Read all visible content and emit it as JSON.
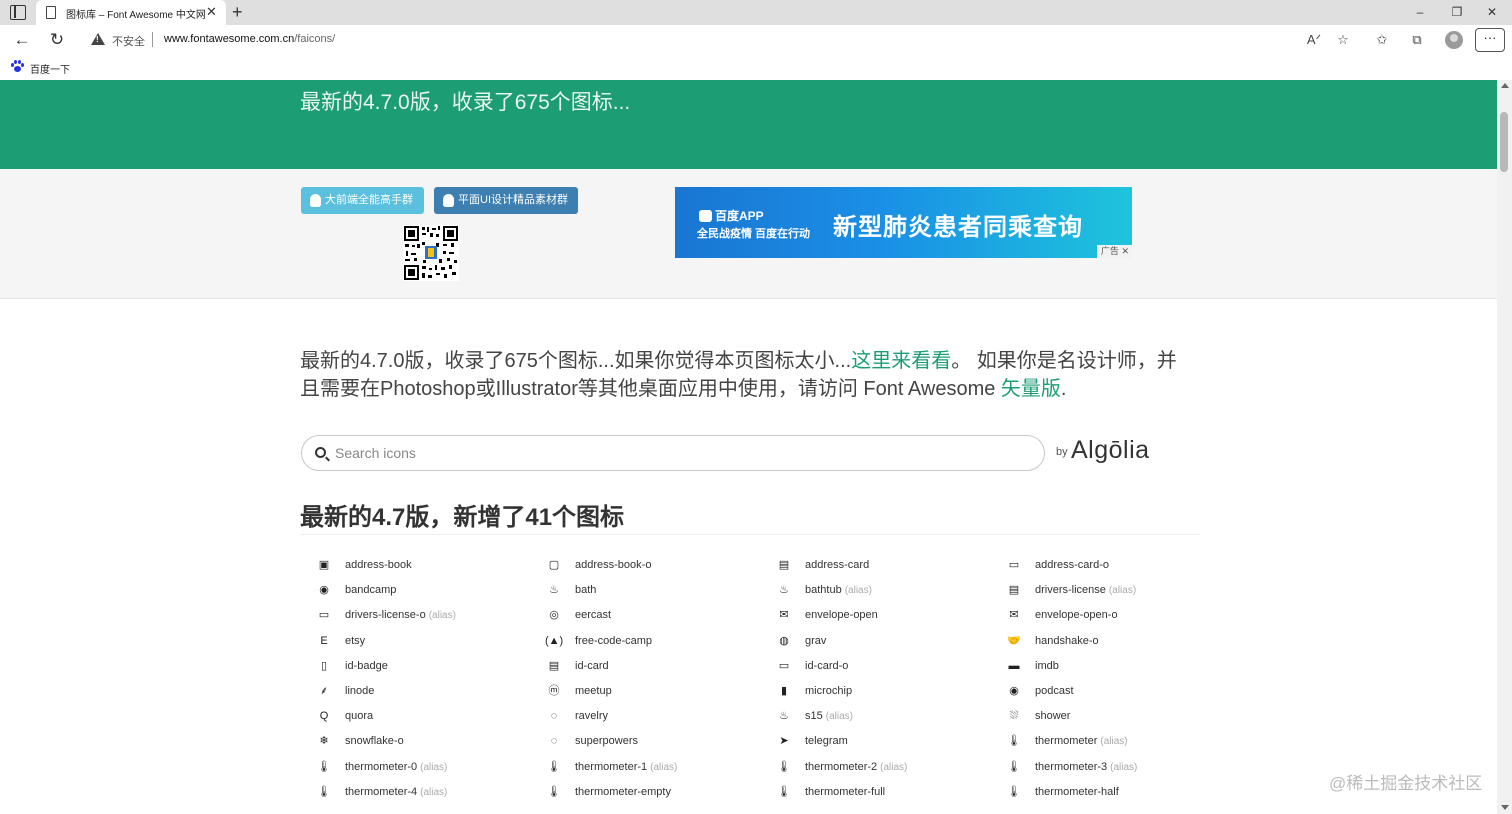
{
  "browser": {
    "tab_title": "图标库 – Font Awesome 中文网",
    "tab_close": "✕",
    "new_tab": "+",
    "security_label": "不安全",
    "url_host": "www.fontawesome.com.cn",
    "url_path": "/faicons/",
    "bookmark_label": "百度一下",
    "min_glyph": "–",
    "restore_glyph": "❐",
    "close_glyph": "✕",
    "back_glyph": "←",
    "reload_glyph": "↻",
    "read_aloud_glyph": "Aᐟ",
    "fav_add_glyph": "☆",
    "favorites_glyph": "✩",
    "collections_glyph": "⧉",
    "more_glyph": "···"
  },
  "hero": {
    "title": "最新的4.7.0版，收录了675个图标..."
  },
  "ads": {
    "group_btn_1": "大前端全能高手群",
    "group_btn_2": "平面UI设计精品素材群",
    "banner_app": "百度APP",
    "banner_sub": "全民战疫情 百度在行动",
    "banner_main": "新型肺炎患者同乘查询",
    "banner_ad_label": "广告",
    "banner_ad_close": "✕"
  },
  "intro": {
    "part1": "最新的4.7.0版，收录了675个图标...如果你觉得本页图标太小...",
    "link1": "这里来看看",
    "part2": "。 如果你是名设计师，并且需要在Photoshop或Illustrator等其他桌面应用中使用，请访问 Font Awesome ",
    "link2": "矢量版",
    "part3": "."
  },
  "search": {
    "placeholder": "Search icons",
    "by_label": "by",
    "provider": "Algōlia"
  },
  "section": {
    "title": "最新的4.7版，新增了41个图标"
  },
  "icons": [
    {
      "name": "address-book",
      "glyph": "▣",
      "alias": ""
    },
    {
      "name": "address-book-o",
      "glyph": "▢",
      "alias": ""
    },
    {
      "name": "address-card",
      "glyph": "▤",
      "alias": ""
    },
    {
      "name": "address-card-o",
      "glyph": "▭",
      "alias": ""
    },
    {
      "name": "bandcamp",
      "glyph": "◉",
      "alias": ""
    },
    {
      "name": "bath",
      "glyph": "♨",
      "alias": ""
    },
    {
      "name": "bathtub",
      "glyph": "♨",
      "alias": "(alias)"
    },
    {
      "name": "drivers-license",
      "glyph": "▤",
      "alias": "(alias)"
    },
    {
      "name": "drivers-license-o",
      "glyph": "▭",
      "alias": "(alias)"
    },
    {
      "name": "eercast",
      "glyph": "◎",
      "alias": ""
    },
    {
      "name": "envelope-open",
      "glyph": "✉",
      "alias": ""
    },
    {
      "name": "envelope-open-o",
      "glyph": "✉",
      "alias": ""
    },
    {
      "name": "etsy",
      "glyph": "E",
      "alias": ""
    },
    {
      "name": "free-code-camp",
      "glyph": "(▲)",
      "alias": ""
    },
    {
      "name": "grav",
      "glyph": "◍",
      "alias": ""
    },
    {
      "name": "handshake-o",
      "glyph": "🤝",
      "alias": ""
    },
    {
      "name": "id-badge",
      "glyph": "▯",
      "alias": ""
    },
    {
      "name": "id-card",
      "glyph": "▤",
      "alias": ""
    },
    {
      "name": "id-card-o",
      "glyph": "▭",
      "alias": ""
    },
    {
      "name": "imdb",
      "glyph": "▬",
      "alias": ""
    },
    {
      "name": "linode",
      "glyph": "⸙",
      "alias": ""
    },
    {
      "name": "meetup",
      "glyph": "ⓜ",
      "alias": ""
    },
    {
      "name": "microchip",
      "glyph": "▮",
      "alias": ""
    },
    {
      "name": "podcast",
      "glyph": "◉",
      "alias": ""
    },
    {
      "name": "quora",
      "glyph": "Q",
      "alias": ""
    },
    {
      "name": "ravelry",
      "glyph": "◌",
      "alias": ""
    },
    {
      "name": "s15",
      "glyph": "♨",
      "alias": "(alias)"
    },
    {
      "name": "shower",
      "glyph": "⛆",
      "alias": ""
    },
    {
      "name": "snowflake-o",
      "glyph": "❄",
      "alias": ""
    },
    {
      "name": "superpowers",
      "glyph": "◌",
      "alias": ""
    },
    {
      "name": "telegram",
      "glyph": "➤",
      "alias": ""
    },
    {
      "name": "thermometer",
      "glyph": "🌡",
      "alias": "(alias)"
    },
    {
      "name": "thermometer-0",
      "glyph": "🌡",
      "alias": "(alias)"
    },
    {
      "name": "thermometer-1",
      "glyph": "🌡",
      "alias": "(alias)"
    },
    {
      "name": "thermometer-2",
      "glyph": "🌡",
      "alias": "(alias)"
    },
    {
      "name": "thermometer-3",
      "glyph": "🌡",
      "alias": "(alias)"
    },
    {
      "name": "thermometer-4",
      "glyph": "🌡",
      "alias": "(alias)"
    },
    {
      "name": "thermometer-empty",
      "glyph": "🌡",
      "alias": ""
    },
    {
      "name": "thermometer-full",
      "glyph": "🌡",
      "alias": ""
    },
    {
      "name": "thermometer-half",
      "glyph": "🌡",
      "alias": ""
    }
  ],
  "watermark": "@稀土掘金技术社区",
  "colors": {
    "hero_bg": "#1d9d74",
    "link": "#1d9d74",
    "btn_light_blue": "#5bc0de",
    "btn_dark_blue": "#3d7fb0"
  }
}
